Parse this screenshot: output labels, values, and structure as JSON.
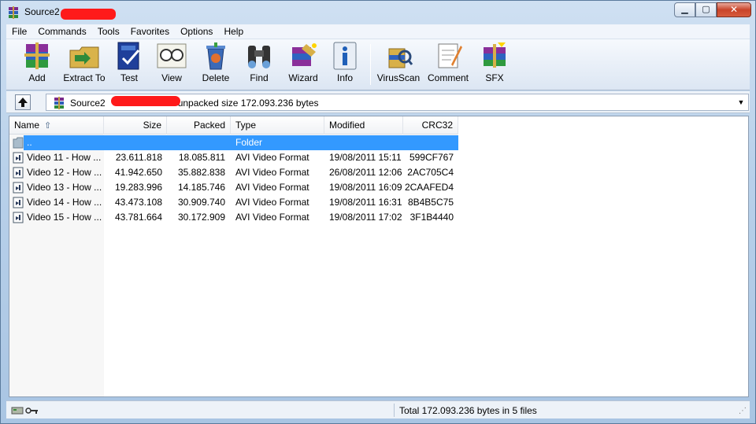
{
  "window": {
    "title": "Source2",
    "controls": {
      "minimize": "▁",
      "maximize": "▢",
      "close": "✕"
    }
  },
  "menu": [
    "File",
    "Commands",
    "Tools",
    "Favorites",
    "Options",
    "Help"
  ],
  "toolbar": {
    "add": "Add",
    "extract": "Extract To",
    "test": "Test",
    "view": "View",
    "delete": "Delete",
    "find": "Find",
    "wizard": "Wizard",
    "info": "Info",
    "virusscan": "VirusScan",
    "comment": "Comment",
    "sfx": "SFX"
  },
  "address": {
    "prefix": "Source2",
    "suffix": "unpacked size 172.093.236 bytes"
  },
  "columns": {
    "name": "Name",
    "size": "Size",
    "packed": "Packed",
    "type": "Type",
    "modified": "Modified",
    "crc": "CRC32"
  },
  "parent_row": {
    "name": "..",
    "type": "Folder"
  },
  "files": [
    {
      "name": "Video 11 - How ...",
      "size": "23.611.818",
      "packed": "18.085.811",
      "type": "AVI Video Format",
      "modified": "19/08/2011 15:11",
      "crc": "599CF767"
    },
    {
      "name": "Video 12 - How ...",
      "size": "41.942.650",
      "packed": "35.882.838",
      "type": "AVI Video Format",
      "modified": "26/08/2011 12:06",
      "crc": "2AC705C4"
    },
    {
      "name": "Video 13 - How ...",
      "size": "19.283.996",
      "packed": "14.185.746",
      "type": "AVI Video Format",
      "modified": "19/08/2011 16:09",
      "crc": "2CAAFED4"
    },
    {
      "name": "Video 14 - How ...",
      "size": "43.473.108",
      "packed": "30.909.740",
      "type": "AVI Video Format",
      "modified": "19/08/2011 16:31",
      "crc": "8B4B5C75"
    },
    {
      "name": "Video 15 - How ...",
      "size": "43.781.664",
      "packed": "30.172.909",
      "type": "AVI Video Format",
      "modified": "19/08/2011 17:02",
      "crc": "3F1B4440"
    }
  ],
  "status": {
    "total": "Total 172.093.236 bytes in 5 files"
  }
}
